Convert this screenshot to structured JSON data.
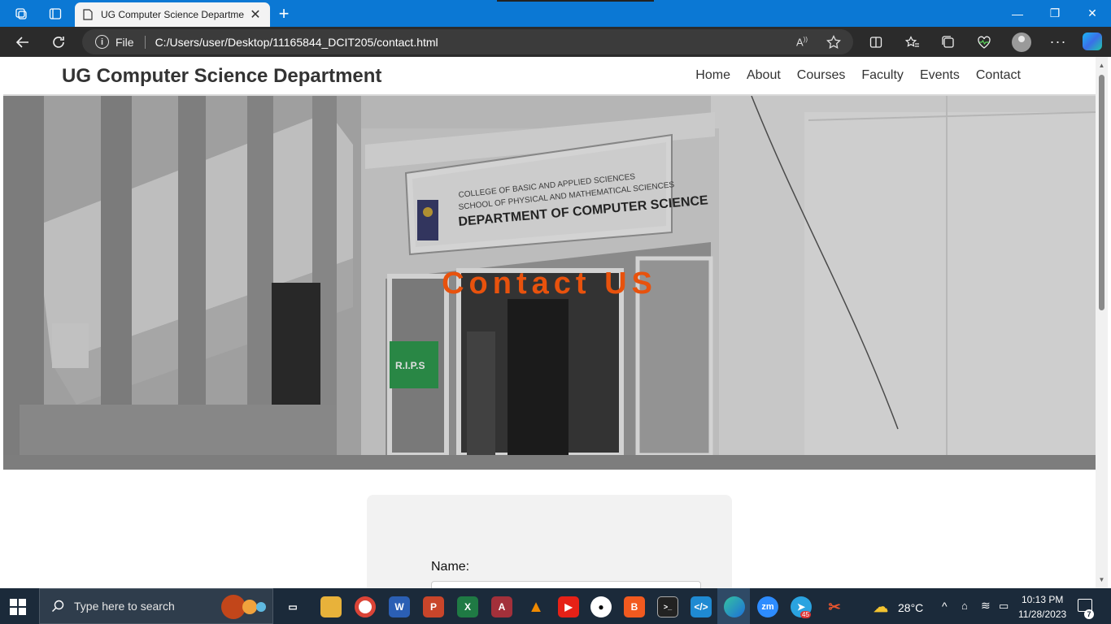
{
  "browser": {
    "tab_title": "UG Computer Science Departme",
    "omnibox_scheme": "File",
    "url": "C:/Users/user/Desktop/11165844_DCIT205/contact.html"
  },
  "site": {
    "title": "UG Computer Science Department",
    "nav": [
      "Home",
      "About",
      "Courses",
      "Faculty",
      "Events",
      "Contact"
    ],
    "hero_title": "Contact US",
    "hero_photo_text": {
      "line1": "COLLEGE OF BASIC AND APPLIED SCIENCES",
      "line2": "SCHOOL OF PHYSICAL AND MATHEMATICAL SCIENCES",
      "line3": "DEPARTMENT OF COMPUTER SCIENCE",
      "sign": "R.I.P.S"
    },
    "form": {
      "name_label": "Name:"
    }
  },
  "taskbar": {
    "search_placeholder": "Type here to search",
    "weather": "28°C",
    "time": "10:13 PM",
    "date": "11/28/2023",
    "notifications": "7",
    "telegram_badge": "45"
  },
  "colors": {
    "accent_blue": "#0b78d4",
    "hero_title": "#e8520d",
    "taskbar": "#1b2a3a"
  }
}
